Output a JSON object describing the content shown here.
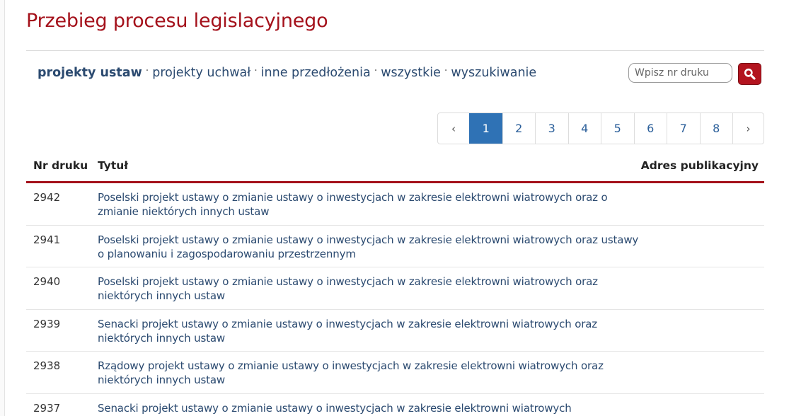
{
  "page": {
    "title": "Przebieg procesu legislacyjnego"
  },
  "nav": {
    "items": [
      {
        "label": "projekty ustaw",
        "active": true
      },
      {
        "label": "projekty uchwał",
        "active": false
      },
      {
        "label": "inne przedłożenia",
        "active": false
      },
      {
        "label": "wszystkie",
        "active": false
      },
      {
        "label": "wyszukiwanie",
        "active": false
      }
    ],
    "separator": "·"
  },
  "search": {
    "placeholder": "Wpisz nr druku",
    "value": "",
    "button_icon": "search-icon"
  },
  "pagination": {
    "prev": "‹",
    "next": "›",
    "pages": [
      "1",
      "2",
      "3",
      "4",
      "5",
      "6",
      "7",
      "8"
    ],
    "current": "1"
  },
  "table": {
    "headers": {
      "nr": "Nr druku",
      "title": "Tytuł",
      "address": "Adres publikacyjny"
    },
    "rows": [
      {
        "nr": "2942",
        "title": "Poselski projekt ustawy o zmianie ustawy o inwestycjach w zakresie elektrowni wiatrowych oraz o zmianie niektórych innych ustaw",
        "address": ""
      },
      {
        "nr": "2941",
        "title": "Poselski projekt ustawy o zmianie ustawy o inwestycjach w zakresie elektrowni wiatrowych oraz ustawy o planowaniu i zagospodarowaniu przestrzennym",
        "address": ""
      },
      {
        "nr": "2940",
        "title": "Poselski projekt ustawy o zmianie ustawy o inwestycjach w zakresie elektrowni wiatrowych oraz niektórych innych ustaw",
        "address": ""
      },
      {
        "nr": "2939",
        "title": "Senacki projekt ustawy o zmianie ustawy o inwestycjach w zakresie elektrowni wiatrowych oraz niektórych innych ustaw",
        "address": ""
      },
      {
        "nr": "2938",
        "title": "Rządowy projekt ustawy o zmianie ustawy o inwestycjach w zakresie elektrowni wiatrowych oraz niektórych innych ustaw",
        "address": ""
      },
      {
        "nr": "2937",
        "title": "Senacki projekt ustawy o zmianie ustawy o inwestycjach w zakresie elektrowni wiatrowych",
        "address": ""
      }
    ]
  },
  "colors": {
    "brand": "#a4111b",
    "link": "#2b4a70",
    "active_page": "#2f72b5"
  }
}
